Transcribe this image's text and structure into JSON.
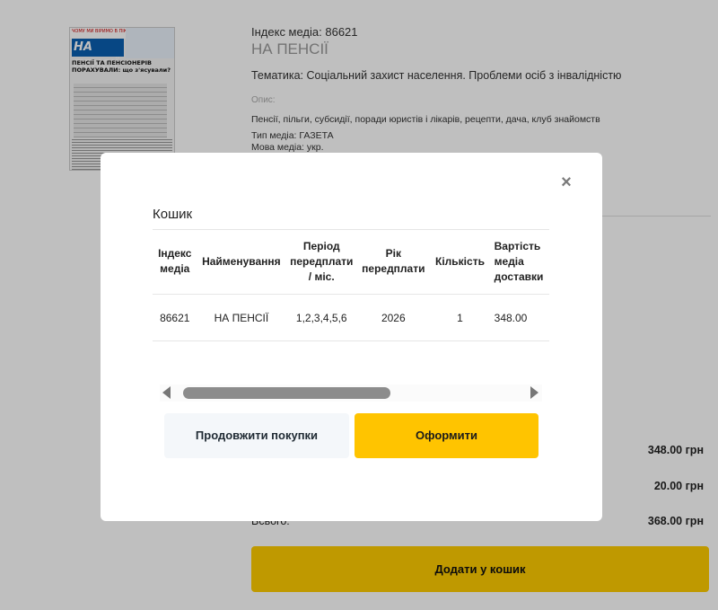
{
  "product": {
    "cover": {
      "top_line": "ЧОМУ МИ ВІРИМО В ПІКИ",
      "logo": "НА ПЕНСІЇ",
      "headline": "ПЕНСІЇ ТА ПЕНСІОНЕРІВ ПОРАХУВАЛИ: що з'ясували?"
    },
    "index_line": "Індекс медіа: 86621",
    "title": "НА ПЕНСІЇ",
    "theme": "Тематика: Соціальний захист населення. Проблеми осіб з інвалідністю",
    "description_label": "Опис:",
    "description": "Пенсії, пільги, субсидії, поради юристів і лікарів, рецепти, дача, клуб знайомств",
    "type": "Тип медіа: ГАЗЕТА",
    "language": "Мова медіа: укр."
  },
  "summary": {
    "rows": [
      {
        "label": "",
        "amount": "348.00 грн"
      },
      {
        "label": "",
        "amount": "20.00 грн"
      },
      {
        "label": "Всього:",
        "amount": "368.00 грн"
      }
    ],
    "add_to_cart_label": "Додати у кошик"
  },
  "modal": {
    "close_symbol": "×",
    "title": "Кошик",
    "table": {
      "headers": [
        "Індекс медіа",
        "Найменування",
        "Період передплати / міс.",
        "Рік передплати",
        "Кількість",
        "Вартість медіа доставки"
      ],
      "rows": [
        [
          "86621",
          "НА ПЕНСІЇ",
          "1,2,3,4,5,6",
          "2026",
          "1",
          "348.00"
        ]
      ]
    },
    "continue_label": "Продовжити покупки",
    "checkout_label": "Оформити"
  },
  "colors": {
    "accent": "#ffc400",
    "overlay": "rgba(0,0,0,0.25)"
  }
}
